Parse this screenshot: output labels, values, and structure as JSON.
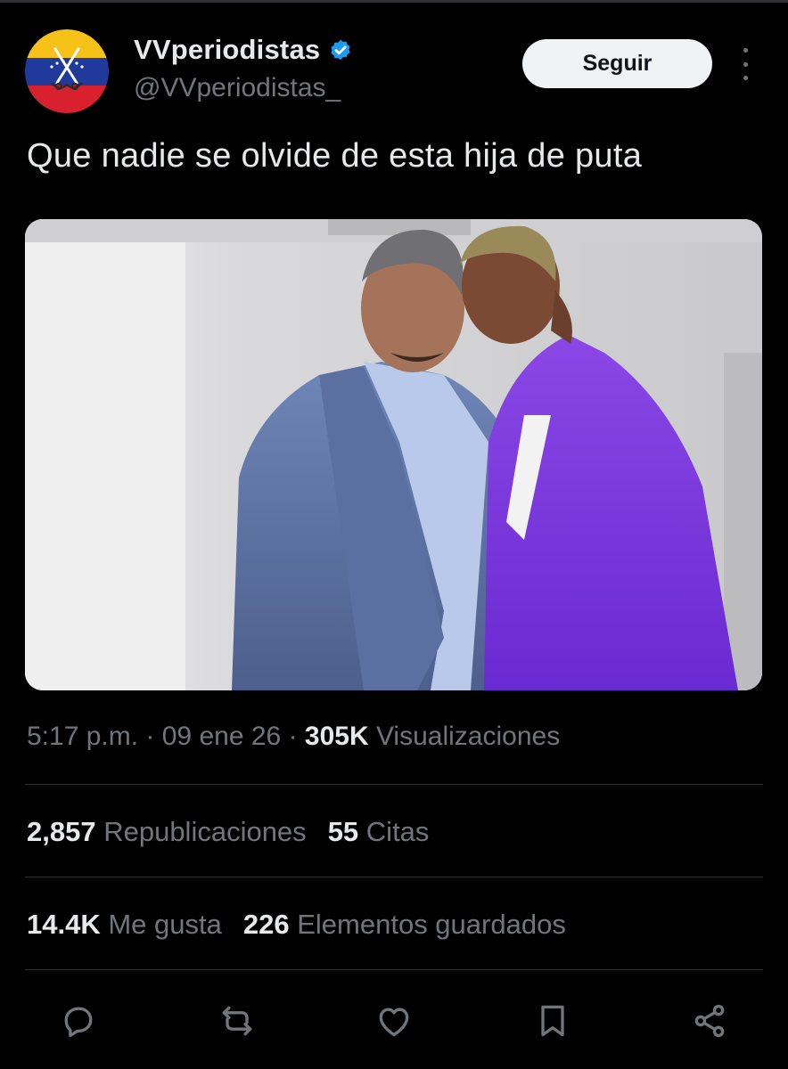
{
  "author": {
    "name": "VVperiodistas",
    "handle": "@VVperiodistas_",
    "verified": true,
    "avatar_icon": "venezuela-flag-avatar"
  },
  "follow_label": "Seguir",
  "tweet": {
    "text": "Que nadie se olvide de esta hija de puta"
  },
  "meta": {
    "time": "5:17 p.m.",
    "sep1": " · ",
    "date": "09 ene 26",
    "sep2": " · ",
    "views_count": "305K",
    "views_label": "Visualizaciones"
  },
  "stats": {
    "reposts_count": "2,857",
    "reposts_label": "Republicaciones",
    "quotes_count": "55",
    "quotes_label": "Citas",
    "likes_count": "14.4K",
    "likes_label": "Me gusta",
    "bookmarks_count": "226",
    "bookmarks_label": "Elementos guardados"
  },
  "actions": [
    "reply-icon",
    "repost-icon",
    "like-icon",
    "bookmark-icon",
    "share-icon"
  ],
  "colors": {
    "background": "#000000",
    "text": "#e7e9ea",
    "muted": "#71767b",
    "divider": "#2f3336",
    "verified": "#1d9bf0",
    "follow_bg": "#eff3f4"
  }
}
